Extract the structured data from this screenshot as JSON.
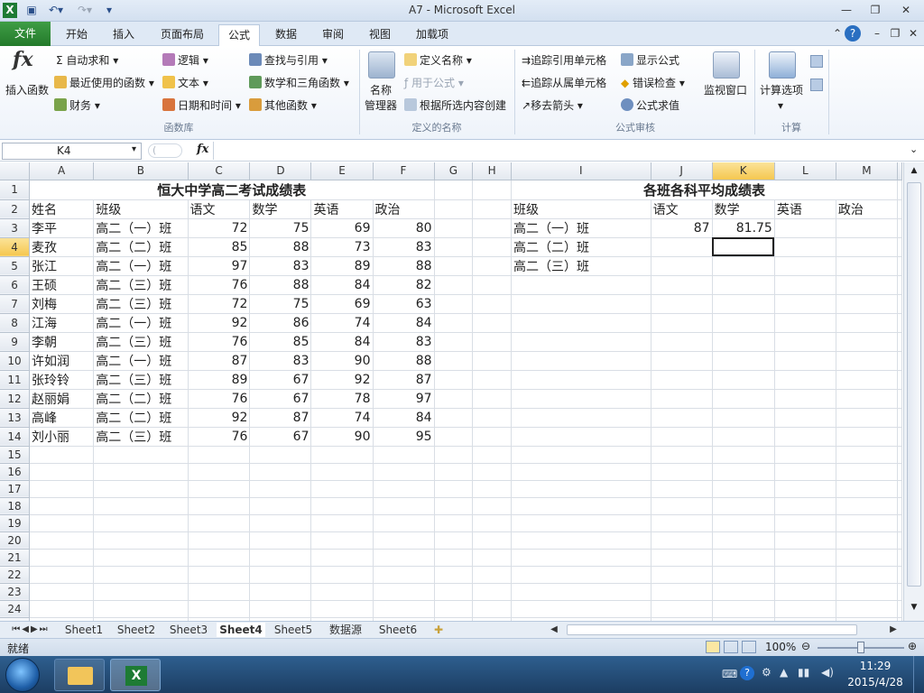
{
  "window": {
    "title": "A7 - Microsoft Excel"
  },
  "tabs": [
    "文件",
    "开始",
    "插入",
    "页面布局",
    "公式",
    "数据",
    "审阅",
    "视图",
    "加载项"
  ],
  "ribbon": {
    "insert_fn": "插入函数",
    "autosum": "自动求和",
    "recent": "最近使用的函数",
    "finance": "财务",
    "logic": "逻辑",
    "text": "文本",
    "datetime": "日期和时间",
    "lookup": "查找与引用",
    "math": "数学和三角函数",
    "other": "其他函数",
    "group_lib": "函数库",
    "name_mgr_1": "名称",
    "name_mgr_2": "管理器",
    "define_name": "定义名称",
    "use_in_formula": "用于公式",
    "create_from_sel": "根据所选内容创建",
    "group_names": "定义的名称",
    "trace_prec": "追踪引用单元格",
    "trace_dep": "追踪从属单元格",
    "remove_arrows": "移去箭头",
    "show_formulas": "显示公式",
    "error_check": "错误检查",
    "eval_formula": "公式求值",
    "watch": "监视窗口",
    "group_audit": "公式审核",
    "calc_options": "计算选项",
    "group_calc": "计算"
  },
  "formula_bar": {
    "namebox": "K4",
    "fx": "fx",
    "formula": ""
  },
  "columns": [
    "A",
    "B",
    "C",
    "D",
    "E",
    "F",
    "G",
    "H",
    "I",
    "J",
    "K",
    "L",
    "M"
  ],
  "rows": [
    [
      "恒大中学高二考试成绩表",
      "",
      "",
      "",
      "",
      "",
      "",
      "",
      "各班各科平均成绩表",
      "",
      "",
      "",
      ""
    ],
    [
      "姓名",
      "班级",
      "语文",
      "数学",
      "英语",
      "政治",
      "",
      "",
      "班级",
      "语文",
      "数学",
      "英语",
      "政治"
    ],
    [
      "李平",
      "高二（一）班",
      "72",
      "75",
      "69",
      "80",
      "",
      "",
      "高二（一）班",
      "87",
      "81.75",
      "",
      ""
    ],
    [
      "麦孜",
      "高二（二）班",
      "85",
      "88",
      "73",
      "83",
      "",
      "",
      "高二（二）班",
      "",
      "",
      "",
      ""
    ],
    [
      "张江",
      "高二（一）班",
      "97",
      "83",
      "89",
      "88",
      "",
      "",
      "高二（三）班",
      "",
      "",
      "",
      ""
    ],
    [
      "王硕",
      "高二（三）班",
      "76",
      "88",
      "84",
      "82",
      "",
      "",
      "",
      "",
      "",
      "",
      ""
    ],
    [
      "刘梅",
      "高二（三）班",
      "72",
      "75",
      "69",
      "63",
      "",
      "",
      "",
      "",
      "",
      "",
      ""
    ],
    [
      "江海",
      "高二（一）班",
      "92",
      "86",
      "74",
      "84",
      "",
      "",
      "",
      "",
      "",
      "",
      ""
    ],
    [
      "李朝",
      "高二（三）班",
      "76",
      "85",
      "84",
      "83",
      "",
      "",
      "",
      "",
      "",
      "",
      ""
    ],
    [
      "许如润",
      "高二（一）班",
      "87",
      "83",
      "90",
      "88",
      "",
      "",
      "",
      "",
      "",
      "",
      ""
    ],
    [
      "张玲铃",
      "高二（三）班",
      "89",
      "67",
      "92",
      "87",
      "",
      "",
      "",
      "",
      "",
      "",
      ""
    ],
    [
      "赵丽娟",
      "高二（二）班",
      "76",
      "67",
      "78",
      "97",
      "",
      "",
      "",
      "",
      "",
      "",
      ""
    ],
    [
      "高峰",
      "高二（二）班",
      "92",
      "87",
      "74",
      "84",
      "",
      "",
      "",
      "",
      "",
      "",
      ""
    ],
    [
      "刘小丽",
      "高二（三）班",
      "76",
      "67",
      "90",
      "95",
      "",
      "",
      "",
      "",
      "",
      "",
      ""
    ],
    [
      "",
      "",
      "",
      "",
      "",
      "",
      "",
      "",
      "",
      "",
      "",
      "",
      ""
    ],
    [
      "",
      "",
      "",
      "",
      "",
      "",
      "",
      "",
      "",
      "",
      "",
      "",
      ""
    ],
    [
      "",
      "",
      "",
      "",
      "",
      "",
      "",
      "",
      "",
      "",
      "",
      "",
      ""
    ],
    [
      "",
      "",
      "",
      "",
      "",
      "",
      "",
      "",
      "",
      "",
      "",
      "",
      ""
    ],
    [
      "",
      "",
      "",
      "",
      "",
      "",
      "",
      "",
      "",
      "",
      "",
      "",
      ""
    ],
    [
      "",
      "",
      "",
      "",
      "",
      "",
      "",
      "",
      "",
      "",
      "",
      "",
      ""
    ],
    [
      "",
      "",
      "",
      "",
      "",
      "",
      "",
      "",
      "",
      "",
      "",
      "",
      ""
    ],
    [
      "",
      "",
      "",
      "",
      "",
      "",
      "",
      "",
      "",
      "",
      "",
      "",
      ""
    ],
    [
      "",
      "",
      "",
      "",
      "",
      "",
      "",
      "",
      "",
      "",
      "",
      "",
      ""
    ],
    [
      "",
      "",
      "",
      "",
      "",
      "",
      "",
      "",
      "",
      "",
      "",
      "",
      ""
    ],
    [
      "",
      "",
      "",
      "",
      "",
      "",
      "",
      "",
      "",
      "",
      "",
      "",
      ""
    ]
  ],
  "sheet_tabs": [
    "Sheet1",
    "Sheet2",
    "Sheet3",
    "Sheet4",
    "Sheet5",
    "数据源",
    "Sheet6"
  ],
  "active_sheet": "Sheet4",
  "status": {
    "ready": "就绪",
    "zoom": "100%"
  },
  "taskbar": {
    "time": "11:29",
    "date": "2015/4/28"
  }
}
